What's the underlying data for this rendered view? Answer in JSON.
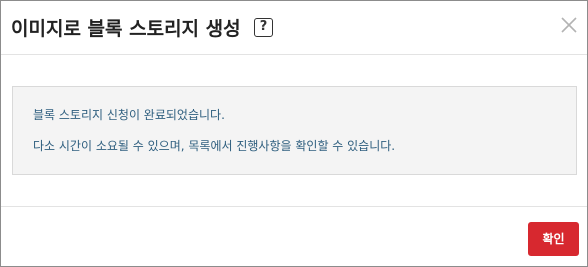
{
  "dialog": {
    "title": "이미지로 블록 스토리지 생성",
    "help_icon_glyph": "?",
    "close_icon": "close-icon"
  },
  "notice": {
    "line1": "블록 스토리지 신청이 완료되었습니다.",
    "line2": "다소 시간이 소요될 수 있으며, 목록에서 진행사항을 확인할 수 있습니다.",
    "text_color": "#2f5f7f",
    "background_color": "#f4f4f4"
  },
  "footer": {
    "confirm_label": "확인",
    "confirm_color": "#d7282f"
  }
}
